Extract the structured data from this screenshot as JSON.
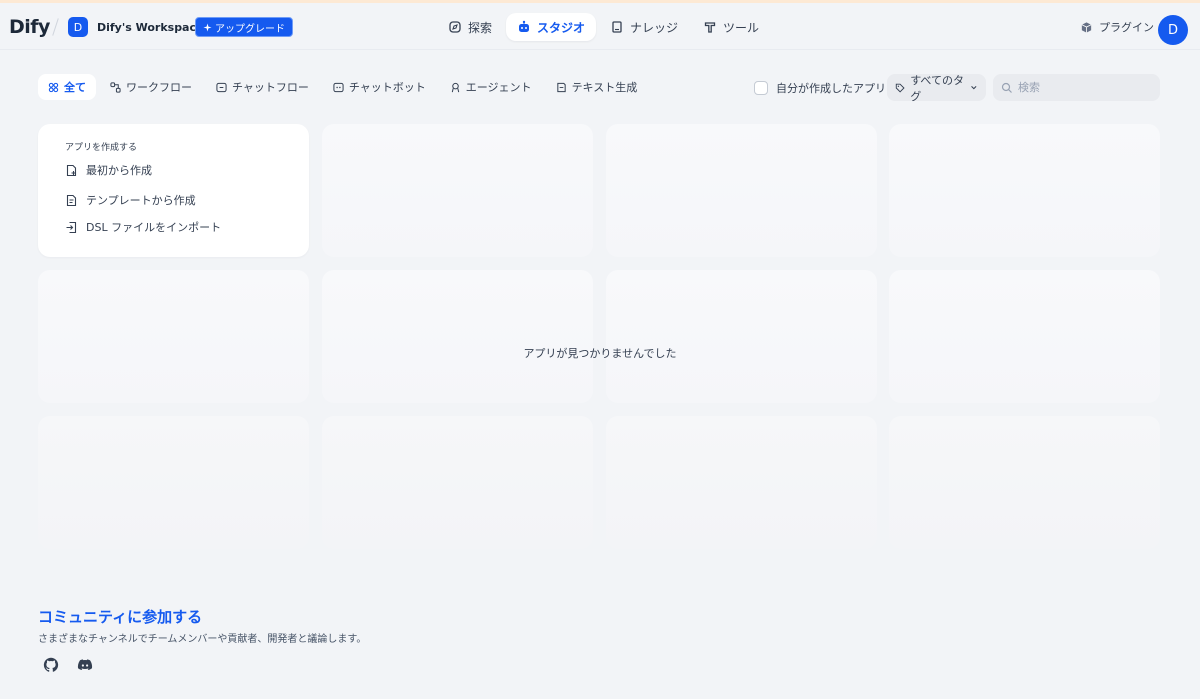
{
  "header": {
    "logo": "Dify",
    "workspace": {
      "initial": "D",
      "name": "Dify's Workspace"
    },
    "upgrade_label": "アップグレード",
    "nav": [
      {
        "label": "探索",
        "icon": "compass-icon",
        "active": false
      },
      {
        "label": "スタジオ",
        "icon": "robot-icon",
        "active": true
      },
      {
        "label": "ナレッジ",
        "icon": "book-icon",
        "active": false
      },
      {
        "label": "ツール",
        "icon": "hammer-icon",
        "active": false
      }
    ],
    "plugin_label": "プラグイン",
    "user_initial": "D"
  },
  "filters": {
    "tabs": [
      {
        "label": "全て",
        "icon": "grid-icon",
        "active": true
      },
      {
        "label": "ワークフロー",
        "icon": "workflow-icon",
        "active": false
      },
      {
        "label": "チャットフロー",
        "icon": "chatflow-icon",
        "active": false
      },
      {
        "label": "チャットボット",
        "icon": "chatbot-icon",
        "active": false
      },
      {
        "label": "エージェント",
        "icon": "agent-icon",
        "active": false
      },
      {
        "label": "テキスト生成",
        "icon": "text-icon",
        "active": false
      }
    ],
    "mine_label": "自分が作成したアプリ",
    "tags_label": "すべてのタグ",
    "search_placeholder": "検索"
  },
  "create_card": {
    "title": "アプリを作成する",
    "items": [
      {
        "label": "最初から作成",
        "icon": "new-file-icon"
      },
      {
        "label": "テンプレートから作成",
        "icon": "template-icon"
      },
      {
        "label": "DSL ファイルをインポート",
        "icon": "import-icon"
      }
    ]
  },
  "empty_message": "アプリが見つかりませんでした",
  "community": {
    "title": "コミュニティに参加する",
    "description": "さまざまなチャンネルでチームメンバーや貢献者、開発者と議論します。",
    "links": [
      {
        "icon": "github-icon"
      },
      {
        "icon": "discord-icon"
      }
    ]
  },
  "colors": {
    "accent": "#155aef",
    "background": "#f2f4f7"
  }
}
